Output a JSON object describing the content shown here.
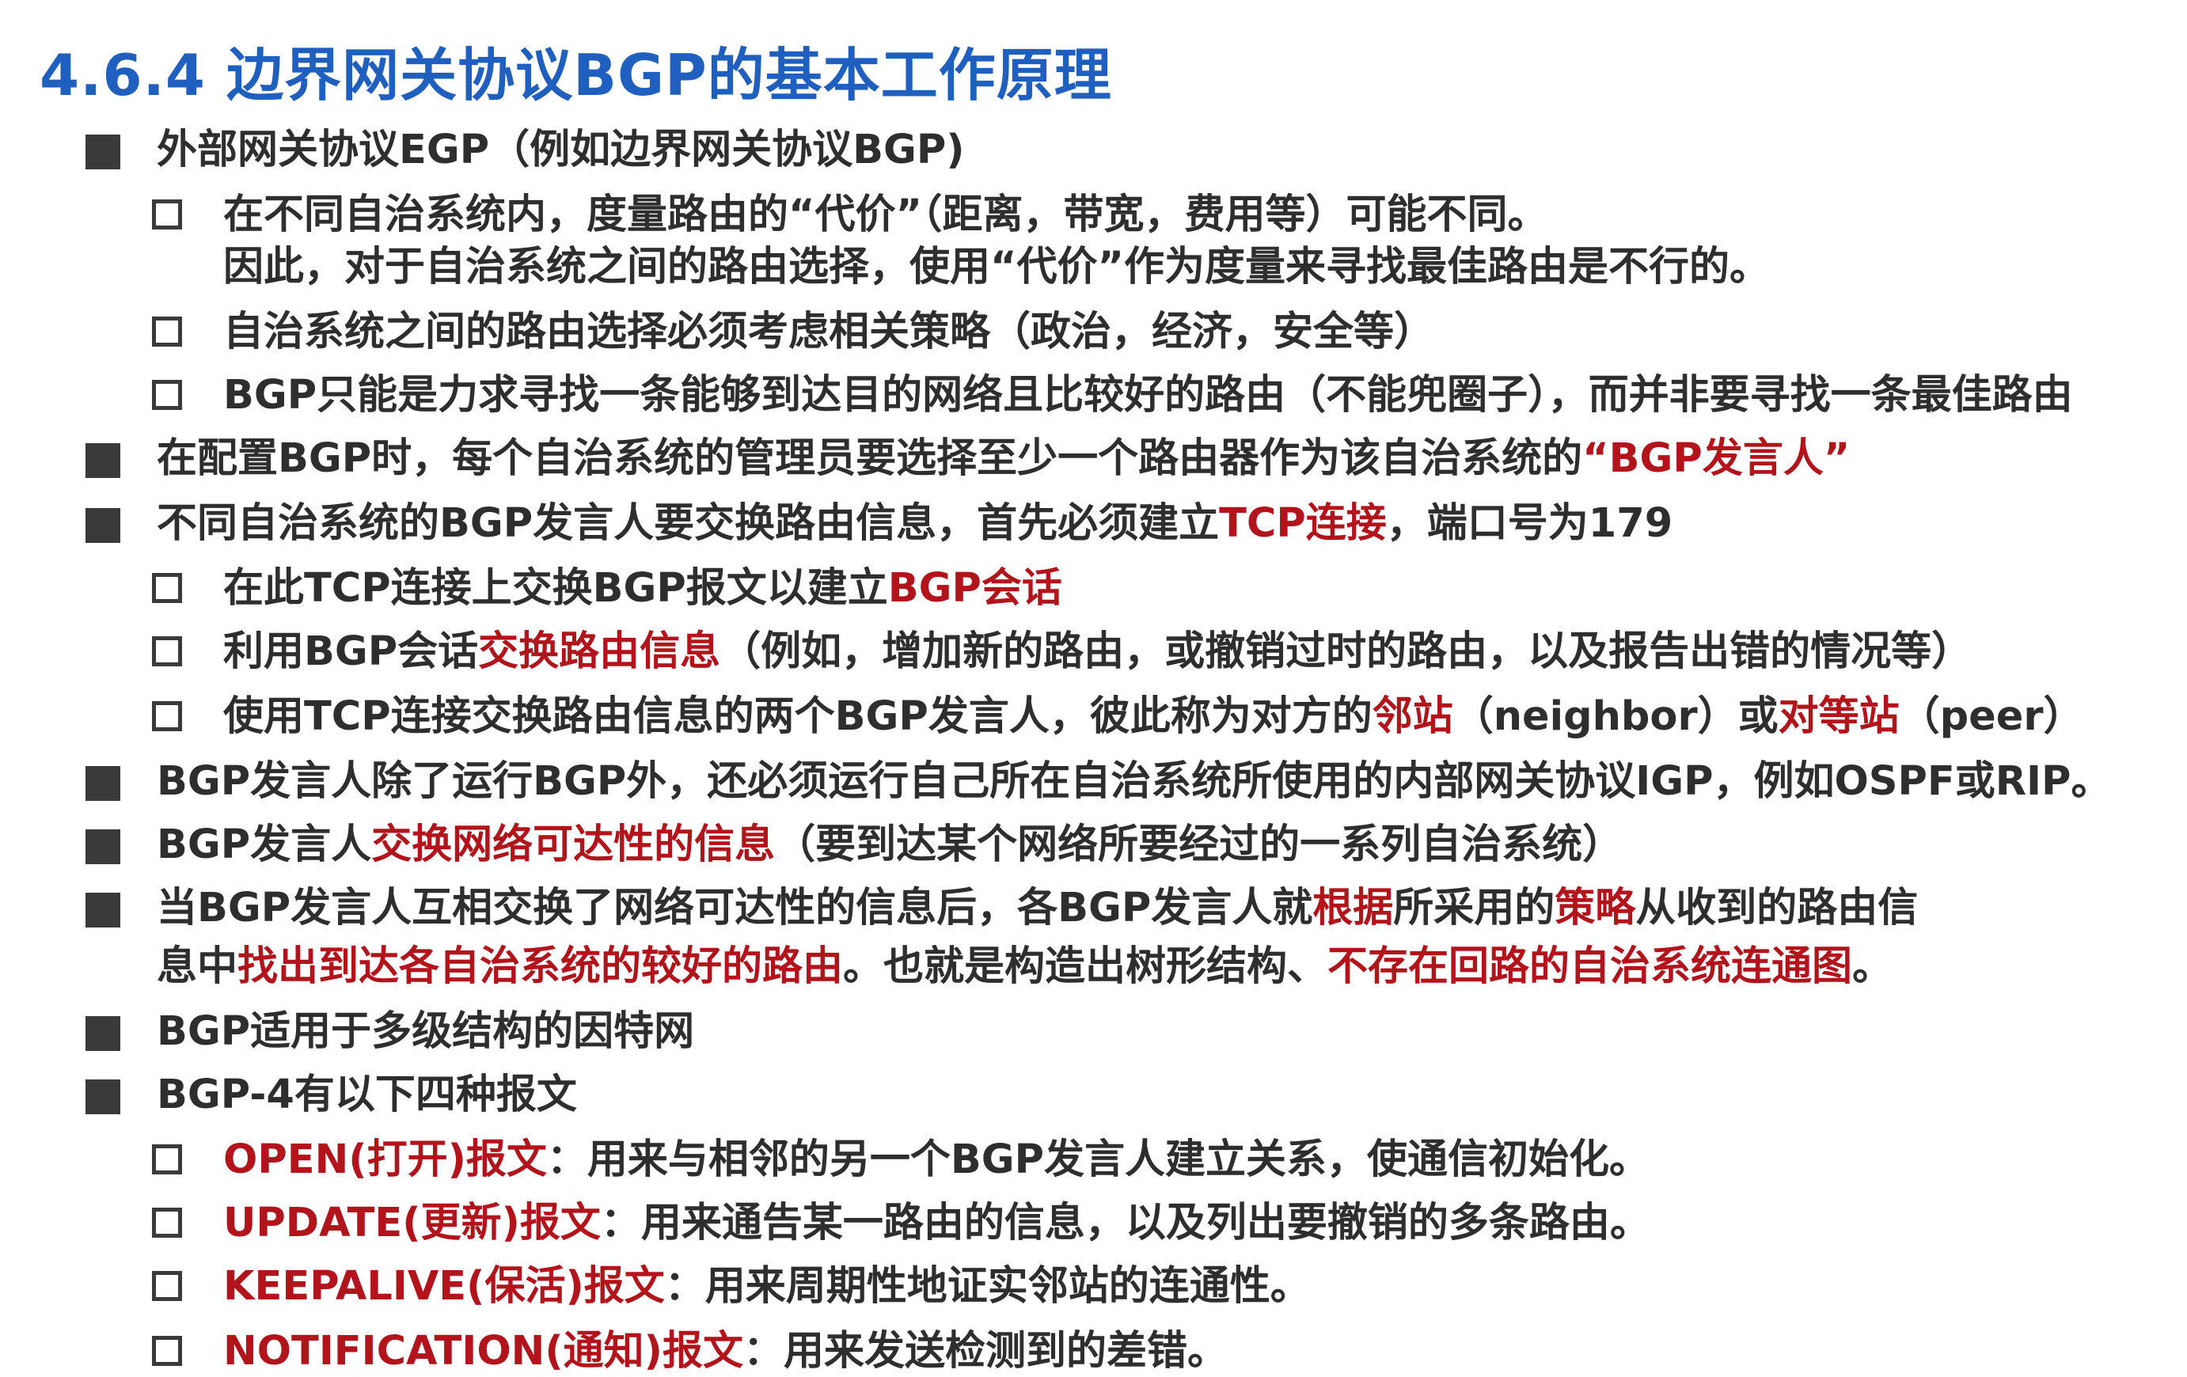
{
  "title": "4.6.4 边界网关协议BGP的基本工作原理",
  "items": [
    {
      "level": 1,
      "segments": [
        {
          "text": "外部网关协议EGP（例如边界网关协议BGP)",
          "red": false
        }
      ]
    },
    {
      "level": 2,
      "segments": [
        {
          "text": "在不同自治系统内，度量路由的“代价”（距离，带宽，费用等）可能不同。",
          "red": false
        }
      ]
    },
    {
      "level": 2,
      "continuation": true,
      "segments": [
        {
          "text": "因此，对于自治系统之间的路由选择，使用“代价”作为度量来寻找最佳路由是不行的。",
          "red": false
        }
      ]
    },
    {
      "level": 2,
      "segments": [
        {
          "text": "自治系统之间的路由选择必须考虑相关策略（政治，经济，安全等）",
          "red": false
        }
      ]
    },
    {
      "level": 2,
      "segments": [
        {
          "text": "BGP只能是力求寻找一条能够到达目的网络且比较好的路由（不能兜圈子），而并非要寻找一条最佳路由",
          "red": false
        }
      ]
    },
    {
      "level": 1,
      "segments": [
        {
          "text": "在配置BGP时，每个自治系统的管理员要选择至少一个路由器作为该自治系统的",
          "red": false
        },
        {
          "text": "“BGP发言人”",
          "red": true
        }
      ]
    },
    {
      "level": 1,
      "segments": [
        {
          "text": "不同自治系统的BGP发言人要交换路由信息，首先必须建立",
          "red": false
        },
        {
          "text": "TCP连接",
          "red": true
        },
        {
          "text": "，端口号为179",
          "red": false
        }
      ]
    },
    {
      "level": 2,
      "segments": [
        {
          "text": "在此TCP连接上交换BGP报文以建立",
          "red": false
        },
        {
          "text": "BGP会话",
          "red": true
        }
      ]
    },
    {
      "level": 2,
      "segments": [
        {
          "text": "利用BGP会话",
          "red": false
        },
        {
          "text": "交换路由信息",
          "red": true
        },
        {
          "text": "（例如，增加新的路由，或撤销过时的路由，以及报告出错的情况等）",
          "red": false
        }
      ]
    },
    {
      "level": 2,
      "segments": [
        {
          "text": "使用TCP连接交换路由信息的两个BGP发言人，彼此称为对方的",
          "red": false
        },
        {
          "text": "邻站",
          "red": true
        },
        {
          "text": "（neighbor）或",
          "red": false
        },
        {
          "text": "对等站",
          "red": true
        },
        {
          "text": "（peer）",
          "red": false
        }
      ]
    },
    {
      "level": 1,
      "segments": [
        {
          "text": "BGP发言人除了运行BGP外，还必须运行自己所在自治系统所使用的内部网关协议IGP，例如OSPF或RIP。",
          "red": false
        }
      ]
    },
    {
      "level": 1,
      "segments": [
        {
          "text": "BGP发言人",
          "red": false
        },
        {
          "text": "交换网络可达性的信息",
          "red": true
        },
        {
          "text": "（要到达某个网络所要经过的一系列自治系统）",
          "red": false
        }
      ]
    },
    {
      "level": 1,
      "segments": [
        {
          "text": "当BGP发言人互相交换了网络可达性的信息后，各BGP发言人就",
          "red": false
        },
        {
          "text": "根据",
          "red": true
        },
        {
          "text": "所采用的",
          "red": false
        },
        {
          "text": "策略",
          "red": true
        },
        {
          "text": "从收到的路由信",
          "red": false
        }
      ]
    },
    {
      "level": 1,
      "continuation": true,
      "segments": [
        {
          "text": "息中",
          "red": false
        },
        {
          "text": "找出到达各自治系统的较好的路由",
          "red": true
        },
        {
          "text": "。也就是构造出树形结构、",
          "red": false
        },
        {
          "text": "不存在回路的自治系统连通图",
          "red": true
        },
        {
          "text": "。",
          "red": false
        }
      ]
    },
    {
      "level": 1,
      "segments": [
        {
          "text": "BGP适用于多级结构的因特网",
          "red": false
        }
      ]
    },
    {
      "level": 1,
      "segments": [
        {
          "text": "BGP-4有以下四种报文",
          "red": false
        }
      ]
    },
    {
      "level": 2,
      "segments": [
        {
          "text": "OPEN(打开)报文",
          "red": true
        },
        {
          "text": "：用来与相邻的另一个BGP发言人建立关系，使通信初始化。",
          "red": false
        }
      ]
    },
    {
      "level": 2,
      "segments": [
        {
          "text": "UPDATE(更新)报文",
          "red": true
        },
        {
          "text": "：用来通告某一路由的信息，以及列出要撤销的多条路由。",
          "red": false
        }
      ]
    },
    {
      "level": 2,
      "segments": [
        {
          "text": "KEEPALIVE(保活)报文",
          "red": true
        },
        {
          "text": "：用来周期性地证实邻站的连通性。",
          "red": false
        }
      ]
    },
    {
      "level": 2,
      "segments": [
        {
          "text": "NOTIFICATION(通知)报文",
          "red": true
        },
        {
          "text": "：用来发送检测到的差错。",
          "red": false
        }
      ]
    }
  ]
}
